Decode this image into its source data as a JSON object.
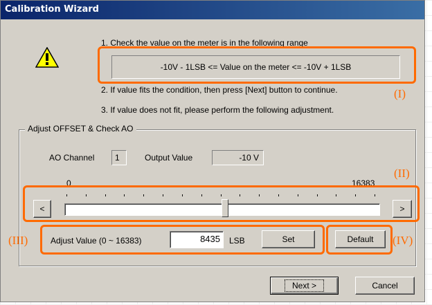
{
  "window": {
    "title": "Calibration Wizard"
  },
  "icons": {
    "warning": "warning-icon"
  },
  "steps": {
    "step1": "1. Check the value on the meter is in the following range",
    "range_text": "-10V - 1LSB <=  Value on the meter  <= -10V + 1LSB",
    "step2": "2. If value fits the condition, then press [Next] button to continue.",
    "step3": "3. If value does not fit, please perform the following adjustment."
  },
  "group": {
    "title": "Adjust OFFSET & Check AO",
    "ao_channel_label": "AO Channel",
    "ao_channel_value": "1",
    "output_value_label": "Output Value",
    "output_value": "-10 V"
  },
  "slider": {
    "min_label": "0",
    "max_label": "16383",
    "value": 8435,
    "min": 0,
    "max": 16383,
    "left_button": "<",
    "right_button": ">"
  },
  "adjust": {
    "label": "Adjust Value (0 ~ 16383)",
    "value": "8435",
    "unit": "LSB",
    "set_button": "Set",
    "default_button": "Default"
  },
  "footer": {
    "next_button": "Next >",
    "cancel_button": "Cancel"
  },
  "annotations": {
    "I": "(I)",
    "II": "(II)",
    "III": "(III)",
    "IV": "(IV)",
    "color": "#ff6a00"
  }
}
